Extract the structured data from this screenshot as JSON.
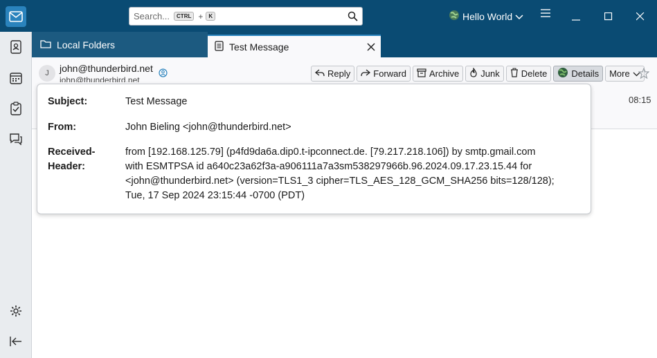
{
  "titlebar": {
    "search_placeholder": "Search...",
    "shortcut_key1": "CTRL",
    "shortcut_plus": "+",
    "shortcut_key2": "K",
    "profile_name": "Hello World"
  },
  "tabs": [
    {
      "label": "Local Folders"
    },
    {
      "label": "Test Message"
    }
  ],
  "header": {
    "avatar_initial": "J",
    "from_email": "john@thunderbird.net",
    "from_email_secondary": "john@thunderbird.net",
    "time": "08:15",
    "actions": {
      "reply": "Reply",
      "forward": "Forward",
      "archive": "Archive",
      "junk": "Junk",
      "delete": "Delete",
      "details": "Details",
      "more": "More"
    }
  },
  "details": {
    "subject_label": "Subject:",
    "subject_value": "Test Message",
    "from_label": "From:",
    "from_value": "John Bieling <john@thunderbird.net>",
    "received_label_1": "Received-",
    "received_label_2": "Header:",
    "received_lines": [
      "from [192.168.125.79] (p4fd9da6a.dip0.t-ipconnect.de. [79.217.218.106]) by smtp.gmail.com",
      "with ESMTPSA id a640c23a62f3a-a906111a7a3sm538297966b.96.2024.09.17.23.15.44 for",
      "<john@thunderbird.net> (version=TLS1_3 cipher=TLS_AES_128_GCM_SHA256 bits=128/128);",
      "Tue, 17 Sep 2024 23:15:44 -0700 (PDT)"
    ]
  },
  "colors": {
    "titlebar": "#0a4b73",
    "accent": "#2a83bd"
  }
}
